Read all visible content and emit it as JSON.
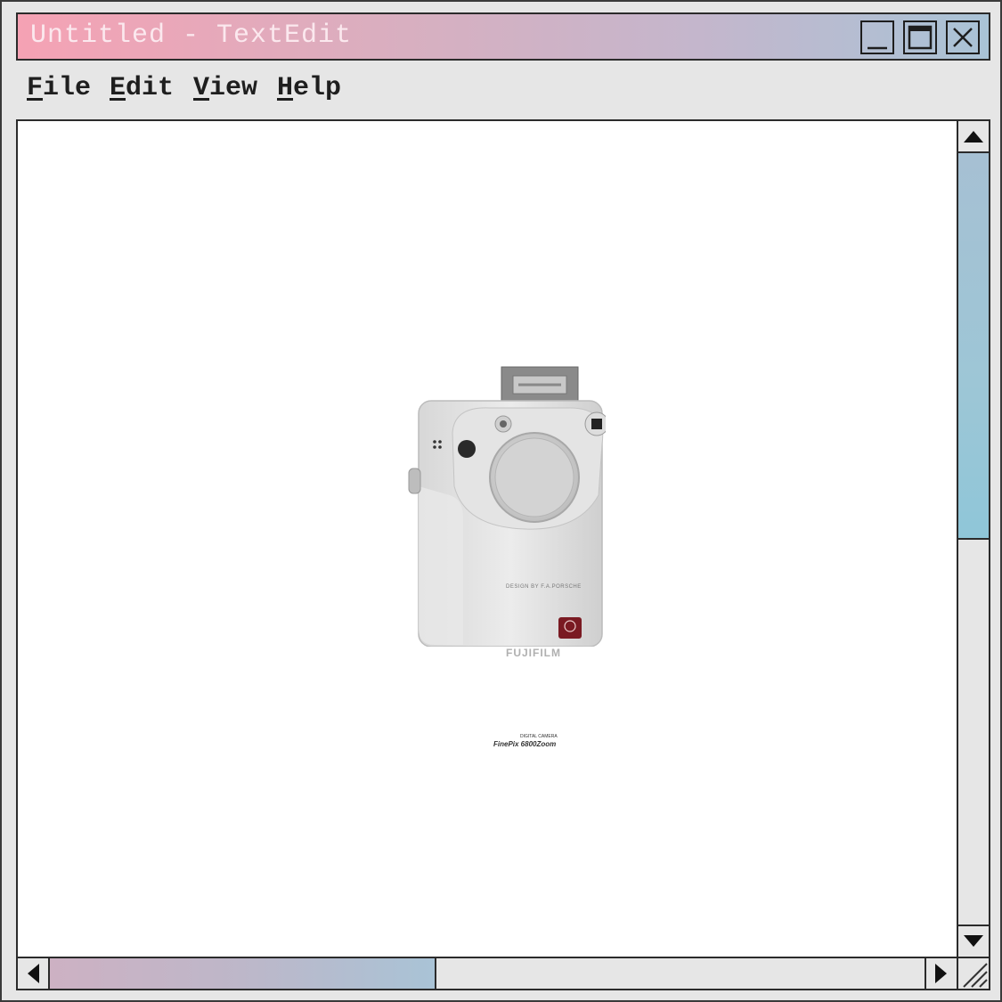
{
  "window": {
    "title": "Untitled - TextEdit",
    "controls": {
      "minimize": "minimize",
      "maximize": "maximize",
      "close": "close"
    }
  },
  "menu": {
    "items": [
      {
        "first": "F",
        "rest": "ile"
      },
      {
        "first": "E",
        "rest": "dit"
      },
      {
        "first": "V",
        "rest": "iew"
      },
      {
        "first": "H",
        "rest": "elp"
      }
    ]
  },
  "document": {
    "image": {
      "subject": "digital camera",
      "lens_text": "DESIGN BY F.A.PORSCHE",
      "brand": "FUJIFILM",
      "label_top": "DIGITAL CAMERA",
      "model": "FinePix 6800Zoom"
    }
  },
  "colors": {
    "titlebar_gradient": [
      "#f5a2b4",
      "#a9c3d6"
    ],
    "vscroll_thumb": "#9dc6d6",
    "hscroll_thumb": "#bdb7c9",
    "frame": "#e6e6e6",
    "border": "#2b2b2b"
  }
}
